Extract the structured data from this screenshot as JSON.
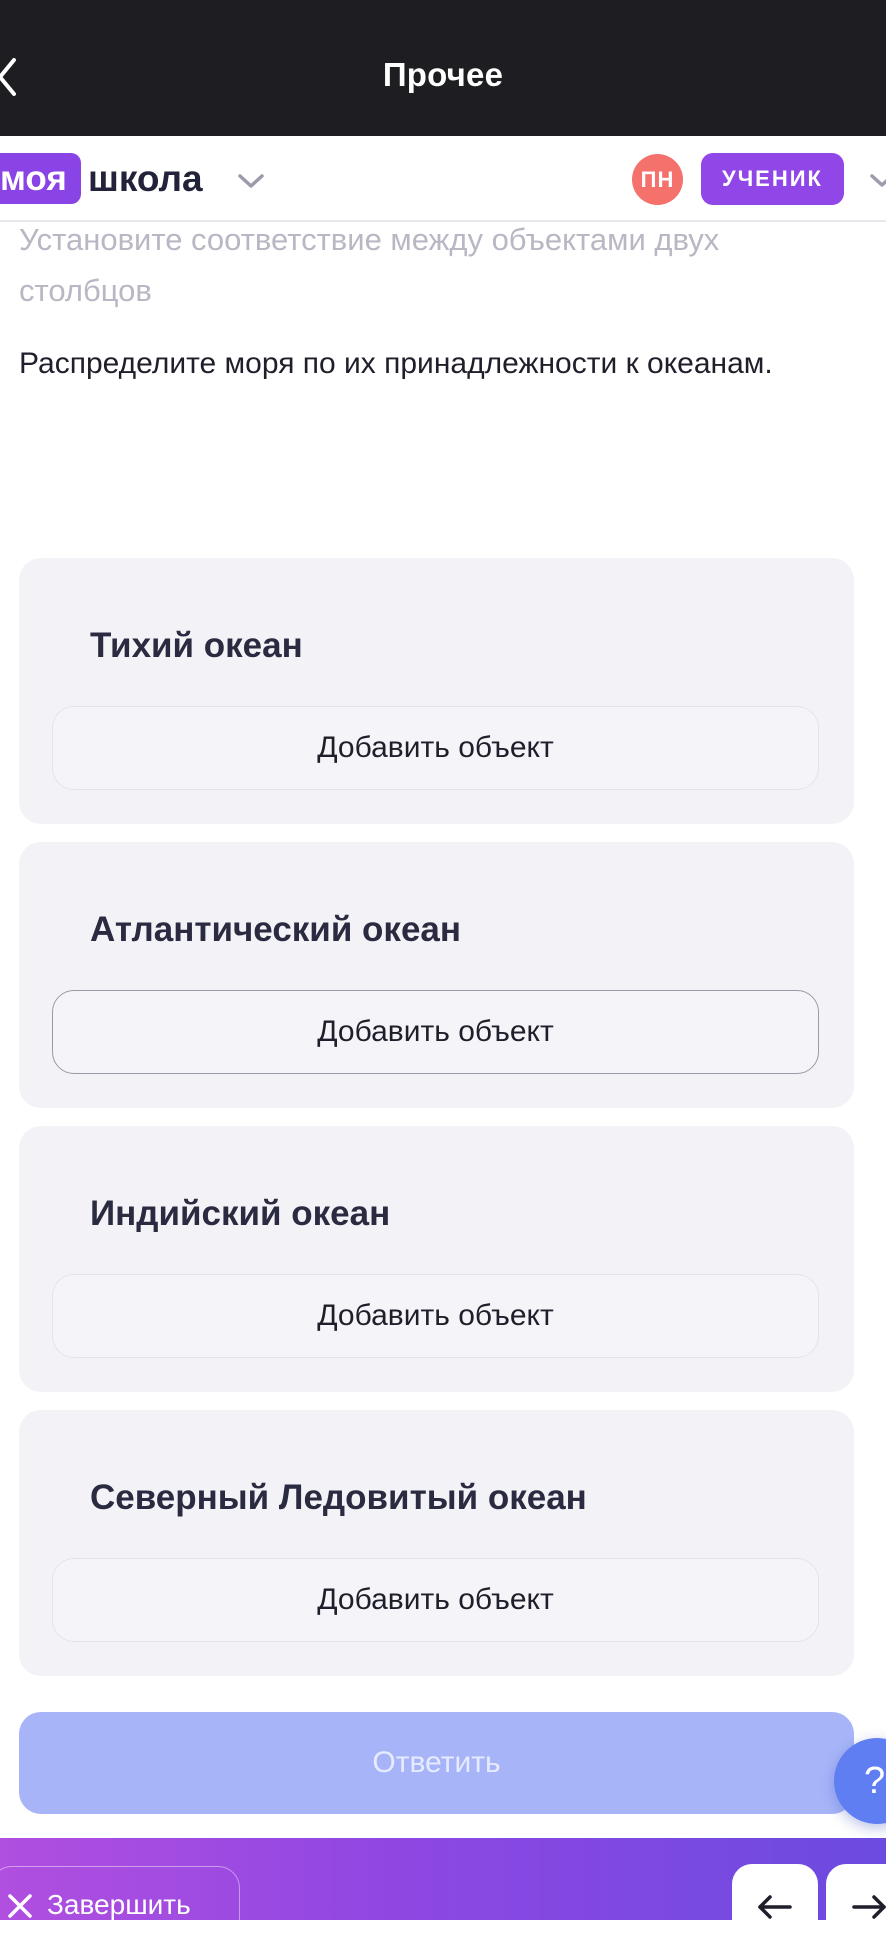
{
  "header": {
    "title": "Прочее"
  },
  "brand": {
    "logo_part1": "моя",
    "logo_part2": "школа",
    "user_initials": "ПН",
    "role_label": "УЧЕНИК"
  },
  "task": {
    "instruction": "Установите соответствие между объектами двух столбцов",
    "question": "Распределите моря по их принадлежности к океанам."
  },
  "groups": [
    {
      "title": "Тихий океан",
      "add_label": "Добавить объект"
    },
    {
      "title": "Атлантический океан",
      "add_label": "Добавить объект"
    },
    {
      "title": "Индийский океан",
      "add_label": "Добавить объект"
    },
    {
      "title": "Северный Ледовитый океан",
      "add_label": "Добавить объект"
    }
  ],
  "actions": {
    "submit_label": "Ответить",
    "help_label": "?",
    "finish_label": "Завершить"
  },
  "icons": {
    "back": "chevron-left-icon",
    "school_dropdown": "chevron-down-icon",
    "role_dropdown": "chevron-down-icon",
    "finish": "close-icon",
    "prev": "arrow-left-icon",
    "next": "arrow-right-icon"
  },
  "colors": {
    "topbar": "#1e1e22",
    "brand_purple": "#8a44e6",
    "avatar": "#f4716c",
    "submit_disabled": "#a7b5f8",
    "help": "#5f7ef2"
  }
}
